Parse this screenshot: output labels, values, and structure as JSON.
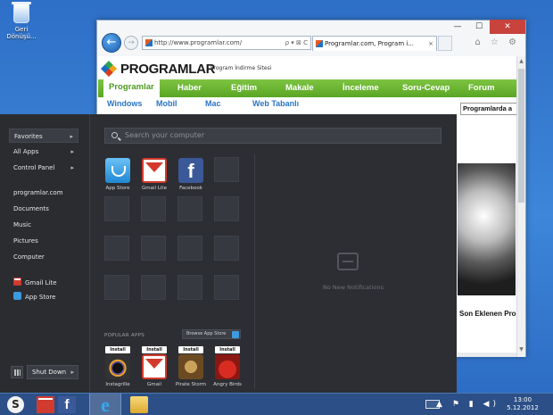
{
  "desktop": {
    "recycle_bin_label_1": "Geri",
    "recycle_bin_label_2": "Dönüşü..."
  },
  "browser": {
    "address": "http://www.programlar.com/",
    "address_controls": "ρ ▾ ⊠ C",
    "tab_title": "Programlar.com, Program i...",
    "tools": "⌂ ☆ ⚙",
    "window_controls": {
      "minimize": "—",
      "maximize": "☐",
      "close": "✕"
    },
    "site": {
      "logo": "PROGRAMLAR",
      "tagline": "Program İndirme Sitesi",
      "nav": [
        "Programlar",
        "Haber",
        "Eğitim",
        "Makale",
        "İnceleme",
        "Soru-Cevap",
        "Forum"
      ],
      "subnav": [
        "Windows",
        "Mobil",
        "Mac",
        "Web Tabanlı"
      ],
      "search_text": "Programlarda a",
      "side_heading": "Son Eklenen Pro"
    }
  },
  "start_menu": {
    "search_placeholder": "Search your computer",
    "sidebar": {
      "expandable": [
        {
          "label": "Favorites",
          "arrow": "▸"
        },
        {
          "label": "All Apps",
          "arrow": "▸"
        },
        {
          "label": "Control Panel",
          "arrow": "▸"
        }
      ],
      "places": [
        "programlar.com",
        "Documents",
        "Music",
        "Pictures",
        "Computer"
      ],
      "pinned": [
        "Gmail Lite",
        "App Store"
      ],
      "shutdown_label": "Shut Down",
      "shutdown_arrow": "▸"
    },
    "apps": [
      {
        "name": "App Store",
        "icon": "app-store-icon",
        "glyph": ""
      },
      {
        "name": "Gmail Lite",
        "icon": "gmail-icon",
        "glyph": ""
      },
      {
        "name": "Facebook",
        "icon": "facebook-icon",
        "glyph": "f"
      }
    ],
    "popular_label": "POPULAR APPS",
    "browse_label": "Browse App Store",
    "popular_apps": [
      {
        "name": "Instagrille",
        "install": "Install",
        "icon": "instagrille-icon"
      },
      {
        "name": "Gmail",
        "install": "Install",
        "icon": "gmail-icon"
      },
      {
        "name": "Pirate Storm",
        "install": "Install",
        "icon": "pirate-storm-icon"
      },
      {
        "name": "Angry Birds",
        "install": "Install",
        "icon": "angry-birds-icon"
      }
    ],
    "notifications_empty": "No New Notifications"
  },
  "taskbar": {
    "time": "13:00",
    "date": "5.12.2012",
    "tray": "▲ ⚑ ▮ ◀)",
    "facebook_glyph": "f",
    "ie_glyph": "e"
  }
}
